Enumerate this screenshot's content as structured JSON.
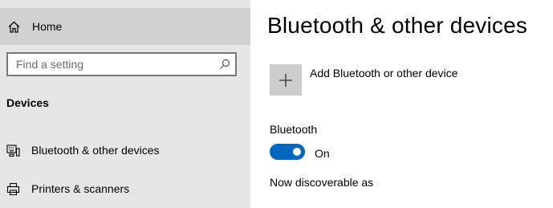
{
  "sidebar": {
    "home": {
      "label": "Home",
      "icon": "home-icon"
    },
    "search": {
      "placeholder": "Find a setting",
      "icon": "search-icon"
    },
    "section_title": "Devices",
    "items": [
      {
        "label": "Bluetooth & other devices",
        "icon": "bluetooth-devices-icon"
      },
      {
        "label": "Printers & scanners",
        "icon": "printer-icon"
      }
    ]
  },
  "main": {
    "title": "Bluetooth & other devices",
    "add_device_label": "Add Bluetooth or other device",
    "bluetooth_heading": "Bluetooth",
    "toggle_state": "On",
    "discoverable_text": "Now discoverable as"
  },
  "colors": {
    "sidebar_bg": "#e6e6e6",
    "home_selected_bg": "#d1d1d1",
    "toggle_on": "#0067c0",
    "add_button_bg": "#cccccc"
  }
}
